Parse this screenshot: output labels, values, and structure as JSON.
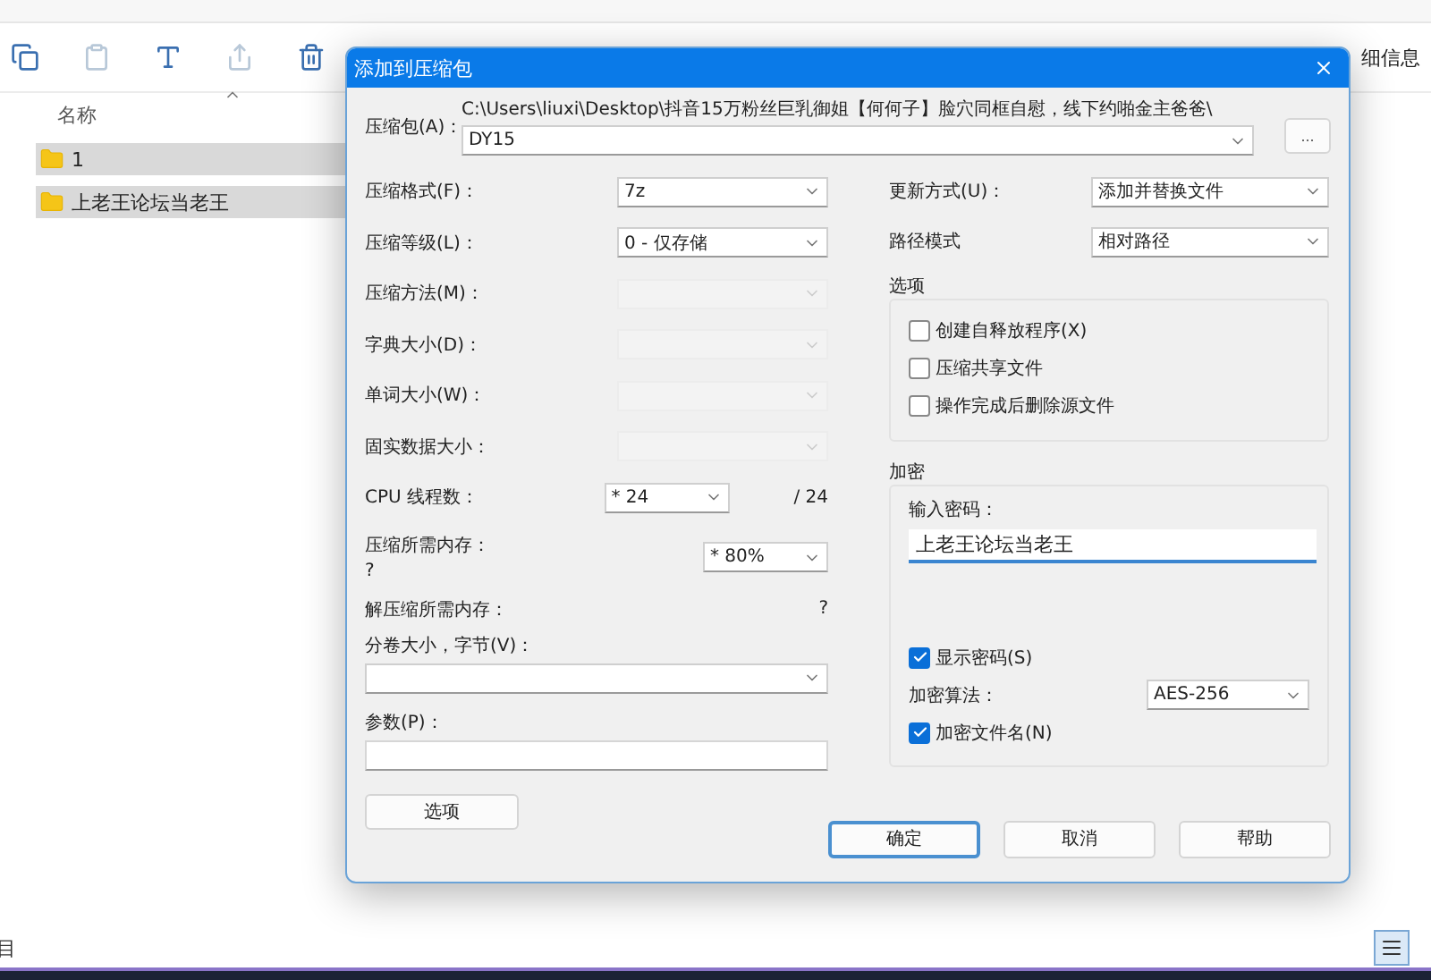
{
  "explorer": {
    "toolbar_label": "细信息",
    "column_header": "名称",
    "rows": [
      {
        "name": "1",
        "selected": true
      },
      {
        "name": "上老王论坛当老王",
        "selected": true
      }
    ],
    "status_text": "目"
  },
  "dialog": {
    "title": "添加到压缩包",
    "archive": {
      "label": "压缩包(A)：",
      "path": "C:\\Users\\liuxi\\Desktop\\抖音15万粉丝巨乳御姐【何何子】脸穴同框自慰，线下约啪金主爸爸\\",
      "value": "DY15",
      "browse": "..."
    },
    "settings": [
      {
        "label": "压缩格式(F)：",
        "value": "7z",
        "disabled": false
      },
      {
        "label": "压缩等级(L)：",
        "value": "0 - 仅存储",
        "disabled": false
      },
      {
        "label": "压缩方法(M)：",
        "disabled": true
      },
      {
        "label": "字典大小(D)：",
        "disabled": true
      },
      {
        "label": "单词大小(W)：",
        "disabled": true
      },
      {
        "label": "固实数据大小：",
        "disabled": true
      }
    ],
    "cpu_threads": {
      "label": "CPU 线程数：",
      "value": "* 24",
      "max": "/ 24"
    },
    "memory_compress": {
      "label": "压缩所需内存：",
      "reading": "?",
      "value": "* 80%"
    },
    "memory_decompress": {
      "label": "解压缩所需内存：",
      "reading": "?"
    },
    "volume": {
      "label": "分卷大小，字节(V)："
    },
    "parameters": {
      "label": "参数(P)："
    },
    "options_button": "选项",
    "update_mode": {
      "label": "更新方式(U)：",
      "value": "添加并替换文件"
    },
    "path_mode": {
      "label": "路径模式",
      "value": "相对路径"
    },
    "options": {
      "title": "选项",
      "items": [
        {
          "label": "创建自释放程序(X)",
          "checked": false
        },
        {
          "label": "压缩共享文件",
          "checked": false
        },
        {
          "label": "操作完成后删除源文件",
          "checked": false
        }
      ]
    },
    "encryption": {
      "title": "加密",
      "password_label": "输入密码：",
      "password": "上老王论坛当老王",
      "show_password": {
        "label": "显示密码(S)",
        "checked": true
      },
      "method": {
        "label": "加密算法：",
        "value": "AES-256"
      },
      "encrypt_names": {
        "label": "加密文件名(N)",
        "checked": true
      }
    },
    "buttons": [
      {
        "label": "确定",
        "default": true
      },
      {
        "label": "取消",
        "default": false
      },
      {
        "label": "帮助",
        "default": false
      }
    ]
  }
}
